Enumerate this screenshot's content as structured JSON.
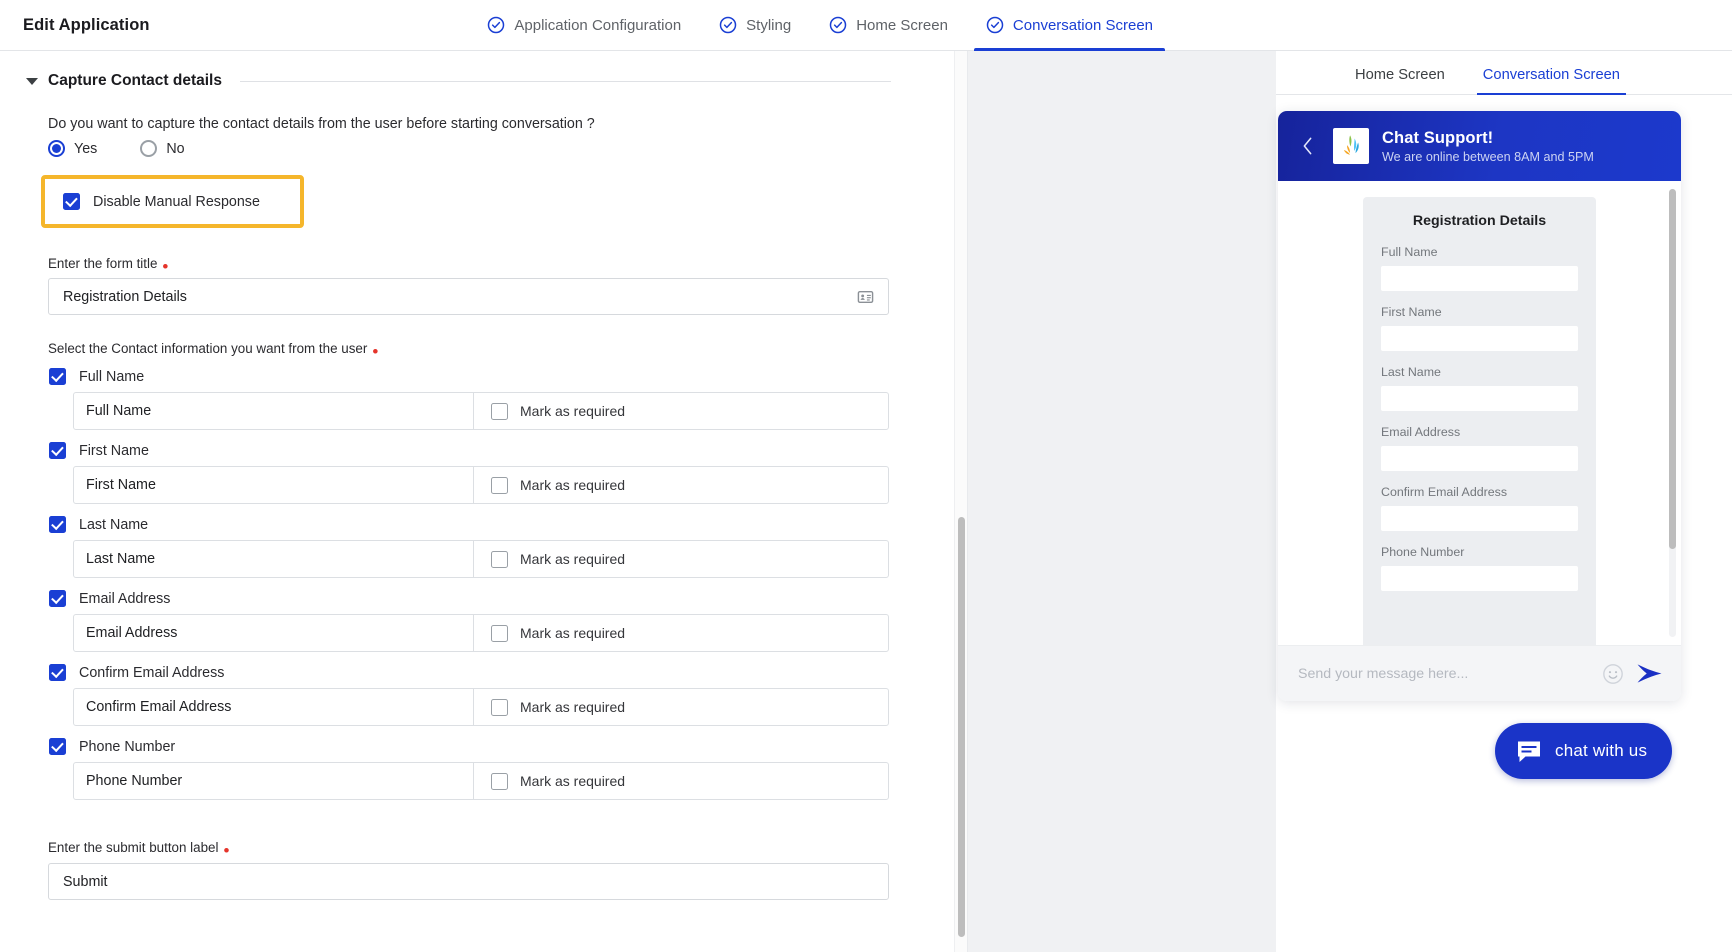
{
  "header": {
    "title": "Edit Application",
    "tabs": [
      {
        "label": "Application Configuration",
        "icon": "check-circle-icon",
        "active": false
      },
      {
        "label": "Styling",
        "icon": "check-circle-icon",
        "active": false
      },
      {
        "label": "Home Screen",
        "icon": "check-circle-icon",
        "active": false
      },
      {
        "label": "Conversation Screen",
        "icon": "check-circle-icon",
        "active": true
      }
    ]
  },
  "form": {
    "section_title": "Capture Contact details",
    "caret_icon": "caret-down-icon",
    "question": "Do you want to capture the contact details from the user before starting conversation ?",
    "radios": [
      {
        "label": "Yes",
        "selected": true
      },
      {
        "label": "No",
        "selected": false
      }
    ],
    "disable_manual_response": {
      "label": "Disable Manual Response",
      "checked": true,
      "highlight_color": "#f5b62b"
    },
    "form_title_label": "Enter the form title",
    "form_title_value": "Registration Details",
    "form_title_icon": "contact-card-icon",
    "contact_info_label": "Select the Contact information you want from the user",
    "required_marker": "*",
    "mark_as_required_label": "Mark as required",
    "contact_fields": [
      {
        "label": "Full Name",
        "checked": true,
        "placeholder": "Full Name",
        "required": false
      },
      {
        "label": "First Name",
        "checked": true,
        "placeholder": "First Name",
        "required": false
      },
      {
        "label": "Last Name",
        "checked": true,
        "placeholder": "Last Name",
        "required": false
      },
      {
        "label": "Email Address",
        "checked": true,
        "placeholder": "Email Address",
        "required": false
      },
      {
        "label": "Confirm Email Address",
        "checked": true,
        "placeholder": "Confirm Email Address",
        "required": false
      },
      {
        "label": "Phone Number",
        "checked": true,
        "placeholder": "Phone Number",
        "required": false
      }
    ],
    "submit_label_caption": "Enter the submit button label",
    "submit_label_value": "Submit"
  },
  "preview": {
    "tabs": [
      {
        "label": "Home Screen",
        "active": false
      },
      {
        "label": "Conversation Screen",
        "active": true
      }
    ],
    "widget": {
      "back_icon": "chevron-left-icon",
      "logo_icon": "brand-splash-logo",
      "title": "Chat Support!",
      "subtitle": "We are online between 8AM and 5PM",
      "header_color_start": "#16239b",
      "header_color_end": "#1c39cc",
      "registration": {
        "title": "Registration Details",
        "fields": [
          {
            "label": "Full Name"
          },
          {
            "label": "First Name"
          },
          {
            "label": "Last Name"
          },
          {
            "label": "Email Address"
          },
          {
            "label": "Confirm Email Address"
          },
          {
            "label": "Phone Number"
          }
        ]
      },
      "composer": {
        "placeholder": "Send your message here...",
        "emoji_icon": "smiley-icon",
        "send_icon": "send-arrow-icon"
      }
    },
    "fab": {
      "label": "chat with us",
      "icon": "chat-bubble-icon",
      "color": "#1a34c8"
    }
  }
}
